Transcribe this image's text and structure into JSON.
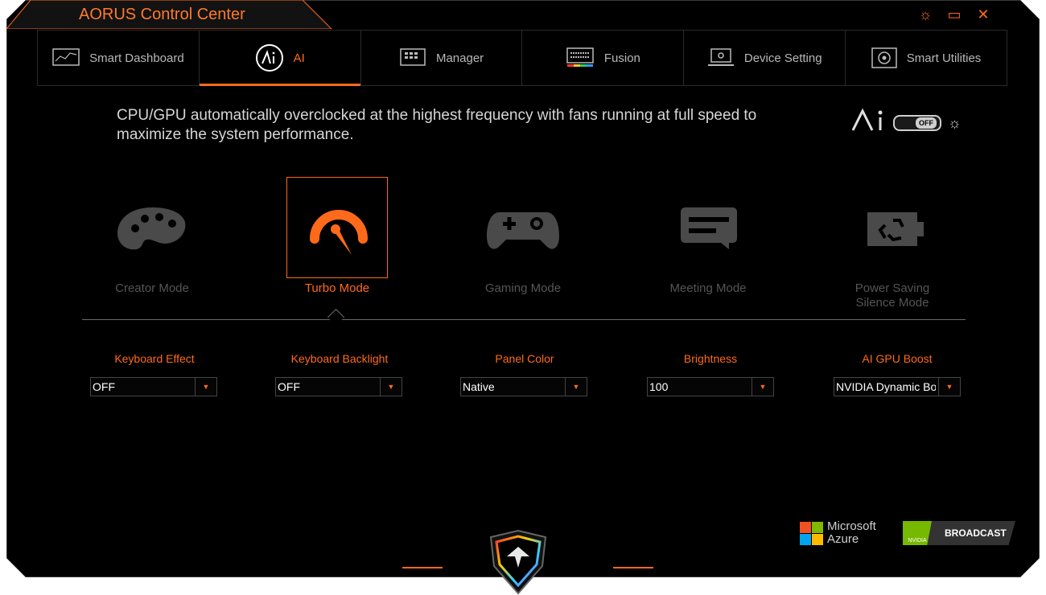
{
  "app": {
    "title": "AORUS Control Center"
  },
  "window_controls": [
    {
      "name": "settings-icon",
      "glyph": "☼"
    },
    {
      "name": "restore-icon",
      "glyph": "▭"
    },
    {
      "name": "close-icon",
      "glyph": "✕"
    }
  ],
  "tabs": [
    {
      "label": "Smart Dashboard",
      "icon": "dashboard-icon"
    },
    {
      "label": "AI",
      "icon": "ai-icon",
      "active": true
    },
    {
      "label": "Manager",
      "icon": "manager-icon"
    },
    {
      "label": "Fusion",
      "icon": "keyboard-icon"
    },
    {
      "label": "Device Setting",
      "icon": "laptop-settings-icon"
    },
    {
      "label": "Smart Utilities",
      "icon": "utilities-icon"
    }
  ],
  "description": "CPU/GPU automatically overclocked at the highest frequency with fans running at full speed to maximize the system performance.",
  "ai_toggle": {
    "logo": "Ai",
    "state": "OFF"
  },
  "modes": [
    {
      "label": "Creator Mode",
      "icon": "palette-icon"
    },
    {
      "label": "Turbo Mode",
      "icon": "speedometer-icon",
      "selected": true
    },
    {
      "label": "Gaming Mode",
      "icon": "gamepad-icon"
    },
    {
      "label": "Meeting Mode",
      "icon": "chat-icon"
    },
    {
      "label_line1": "Power Saving",
      "label_line2": "Silence Mode",
      "icon": "battery-recycle-icon"
    }
  ],
  "settings": [
    {
      "label": "Keyboard Effect",
      "value": "OFF"
    },
    {
      "label": "Keyboard Backlight",
      "value": "OFF"
    },
    {
      "label": "Panel Color",
      "value": "Native"
    },
    {
      "label": "Brightness",
      "value": "100"
    },
    {
      "label": "AI GPU Boost",
      "value": "NVIDIA Dynamic Boost"
    }
  ],
  "logos": {
    "microsoft_line1": "Microsoft",
    "microsoft_line2": "Azure",
    "nvidia_badge": "NVIDIA",
    "nvidia_text": "BROADCAST"
  },
  "colors": {
    "accent": "#ff6a1a",
    "background": "#000000"
  }
}
